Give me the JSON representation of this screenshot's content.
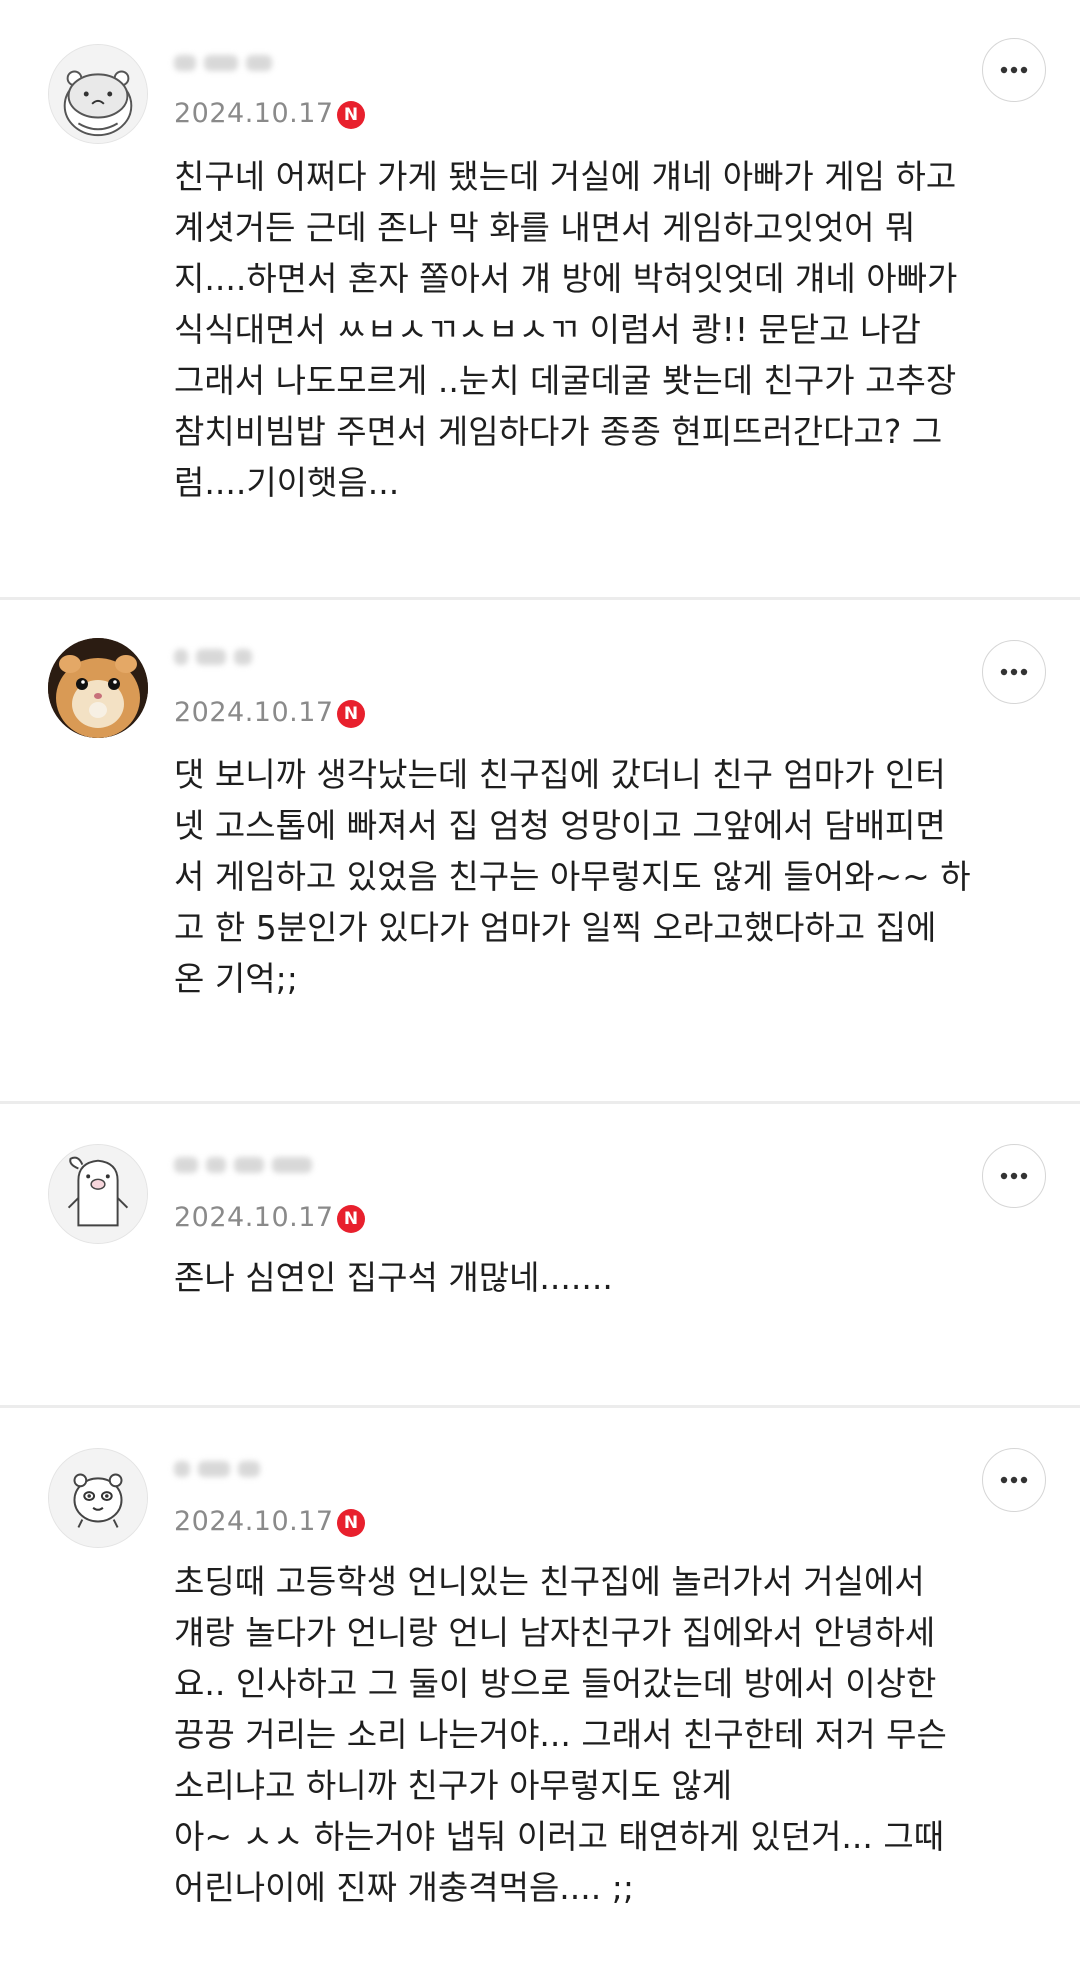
{
  "comments": [
    {
      "author": "",
      "date": "2024.10.17",
      "badge": "N",
      "text": "친구네 어쩌다 가게 됐는데 거실에 걔네 아빠가 게임 하고\n계셧거든 근데 존나 막 화를 내면서 게임하고잇엇어 뭐\n지....하면서 혼자 쫄아서 걔 방에 박혀잇엇데 걔네 아빠가\n식식대면서 ㅆㅂㅅㄲㅅㅂㅅㄲ 이럼서 쾅!! 문닫고 나감\n그래서 나도모르게 ..눈치 데굴데굴 봣는데 친구가 고추장\n참치비빔밥 주면서 게임하다가 종종 현피뜨러간다고? 그\n럼....기이햇음...",
      "avatar": "hamster-drawing-icon"
    },
    {
      "author": "",
      "date": "2024.10.17",
      "badge": "N",
      "text": "댓 보니까 생각났는데 친구집에 갔더니 친구 엄마가 인터\n넷 고스톱에 빠져서 집 엄청 엉망이고 그앞에서 담배피면\n서 게임하고 있었음 친구는 아무렇지도 않게 들어와~~ 하\n고 한 5분인가 있다가 엄마가 일찍 오라고했다하고 집에\n온 기억;;",
      "avatar": "hamster-photo-icon"
    },
    {
      "author": "",
      "date": "2024.10.17",
      "badge": "N",
      "text": "존나 심연인 집구석 개많네.......",
      "avatar": "pig-character-icon"
    },
    {
      "author": "",
      "date": "2024.10.17",
      "badge": "N",
      "text": "초딩때 고등학생 언니있는 친구집에 놀러가서 거실에서\n걔랑 놀다가 언니랑 언니 남자친구가 집에와서 안녕하세\n요.. 인사하고 그 둘이 방으로 들어갔는데 방에서 이상한\n끙끙 거리는 소리 나는거야... 그래서 친구한테 저거 무슨\n소리냐고 하니까 친구가 아무렇지도 않게\n아~ ㅅㅅ 하는거야 냅둬 이러고 태연하게 있던거... 그때\n어린나이에 진짜 개충격먹음.... ;;",
      "avatar": "bear-character-icon"
    }
  ],
  "colors": {
    "badge": "#e8202d",
    "date": "#8a8a8a",
    "divider": "#ececec"
  }
}
